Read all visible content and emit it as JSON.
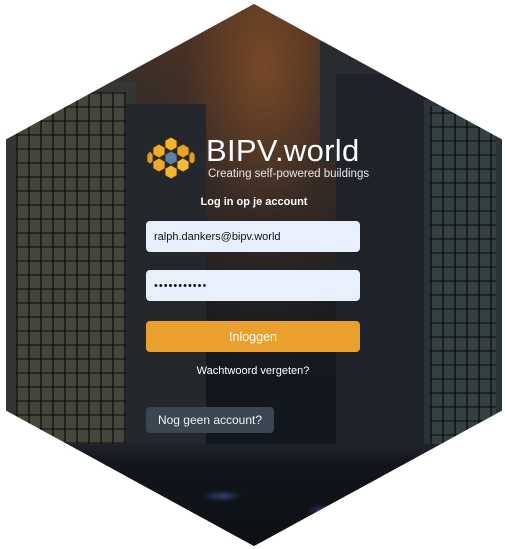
{
  "brand": {
    "logo_icon": "honeycomb-logo-icon",
    "name_bold": "BIPV",
    "name_rest": ".world",
    "tagline": "Creating self-powered buildings"
  },
  "login": {
    "title": "Log in op je account",
    "email_value": "ralph.dankers@bipv.world",
    "password_value": "•••••••••••",
    "login_button": "Inloggen",
    "forgot_link": "Wachtwoord vergeten?",
    "register_button": "Nog geen account?"
  },
  "colors": {
    "accent": "#eaa02c",
    "field_bg": "#e8f0fe",
    "secondary_button": "#3b4653"
  }
}
